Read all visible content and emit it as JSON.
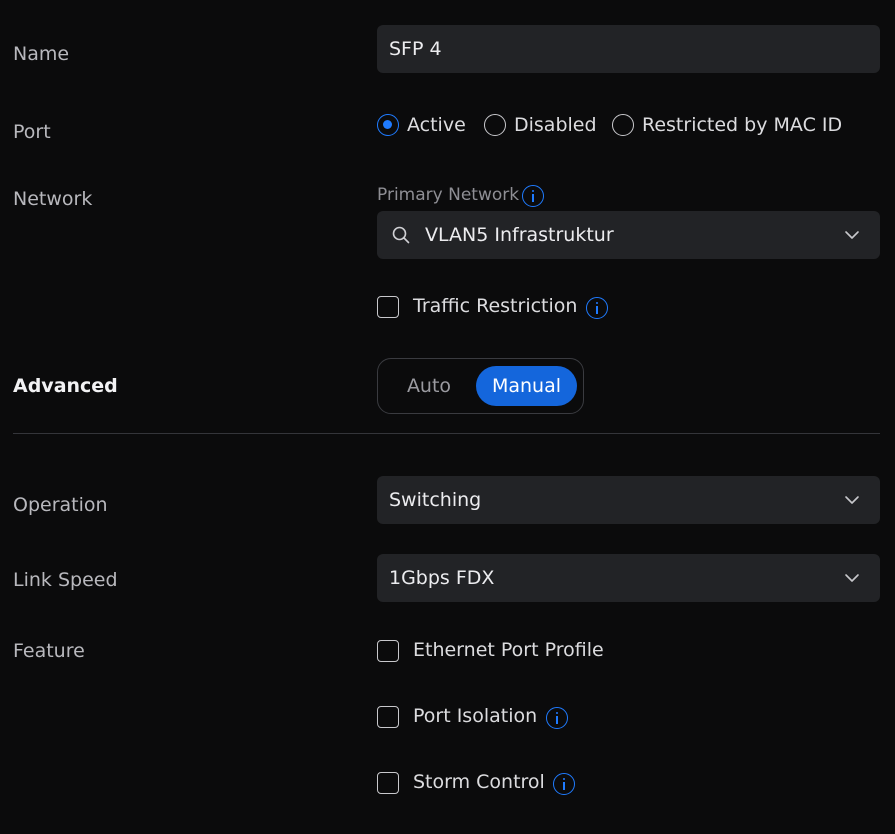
{
  "name": {
    "label": "Name",
    "value": "SFP 4"
  },
  "port": {
    "label": "Port",
    "options": [
      {
        "label": "Active",
        "selected": true
      },
      {
        "label": "Disabled",
        "selected": false
      },
      {
        "label": "Restricted by MAC ID",
        "selected": false
      }
    ]
  },
  "network": {
    "label": "Network",
    "sublabel": "Primary Network",
    "value": "VLAN5 Infrastruktur",
    "traffic_restriction_label": "Traffic Restriction",
    "traffic_restriction_checked": false
  },
  "advanced": {
    "label": "Advanced",
    "options": [
      "Auto",
      "Manual"
    ],
    "selected": "Manual"
  },
  "operation": {
    "label": "Operation",
    "value": "Switching"
  },
  "link_speed": {
    "label": "Link Speed",
    "value": "1Gbps FDX"
  },
  "feature": {
    "label": "Feature",
    "items": [
      {
        "label": "Ethernet Port Profile",
        "checked": false,
        "info": false
      },
      {
        "label": "Port Isolation",
        "checked": false,
        "info": true
      },
      {
        "label": "Storm Control",
        "checked": false,
        "info": true
      }
    ]
  },
  "colors": {
    "background": "#0b0b0c",
    "field": "#222326",
    "accent": "#1f7bff",
    "segment_selected": "#1466dc"
  }
}
